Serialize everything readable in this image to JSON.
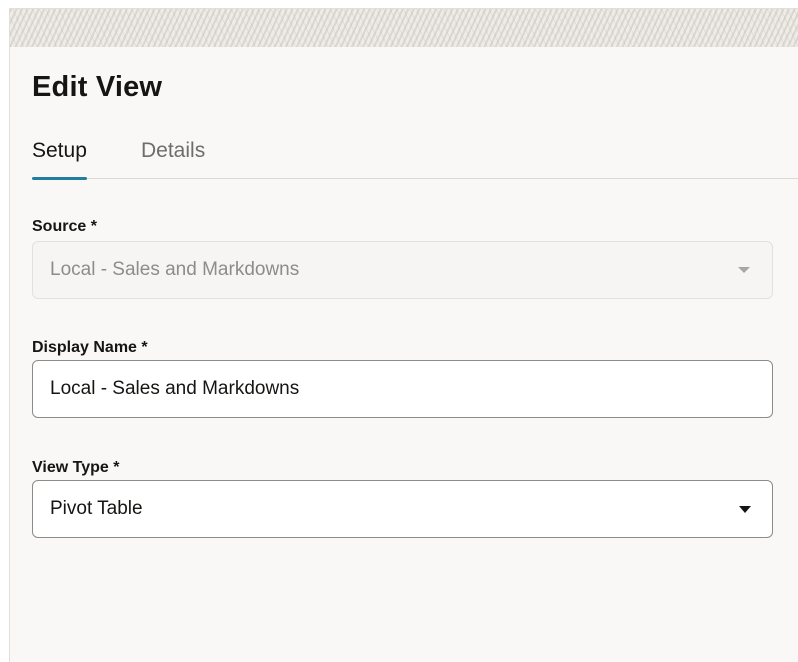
{
  "dialog": {
    "title": "Edit View"
  },
  "tabs": [
    {
      "label": "Setup",
      "active": true
    },
    {
      "label": "Details",
      "active": false
    }
  ],
  "fields": {
    "source": {
      "label": "Source *",
      "value": "Local - Sales and Markdowns",
      "disabled": true,
      "icon": "chevron-down-icon"
    },
    "display_name": {
      "label": "Display Name *",
      "value": "Local - Sales and Markdowns"
    },
    "view_type": {
      "label": "View Type *",
      "value": "Pivot Table",
      "icon": "chevron-down-icon"
    }
  },
  "colors": {
    "tab_indicator": "#227e9e",
    "panel_background": "#f9f8f6",
    "text_primary": "#161513",
    "text_muted": "#6f6c69"
  }
}
